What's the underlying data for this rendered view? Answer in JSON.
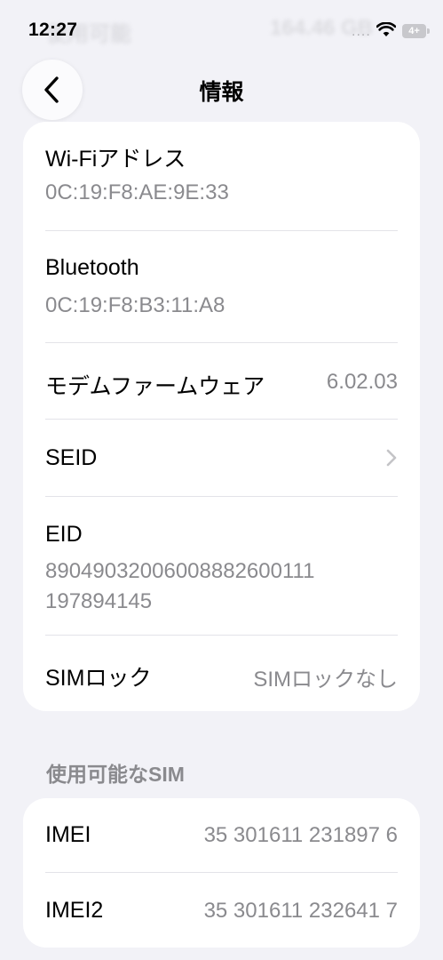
{
  "status_bar": {
    "time": "12:27",
    "ghost_left": "使用可能",
    "ghost_right": "164.46 GB",
    "signal": "....",
    "battery": "4+"
  },
  "nav": {
    "title": "情報",
    "back_icon": "chevron-left-icon"
  },
  "rows": {
    "wifi": {
      "label": "Wi-Fiアドレス",
      "value": "0C:19:F8:AE:9E:33"
    },
    "bluetooth": {
      "label": "Bluetooth",
      "value": "0C:19:F8:B3:11:A8"
    },
    "modem": {
      "label": "モデムファームウェア",
      "value": "6.02.03"
    },
    "seid": {
      "label": "SEID",
      "icon": "chevron-right-icon"
    },
    "eid": {
      "label": "EID",
      "value_line1": "89049032006008882600111",
      "value_line2": "197894145"
    },
    "simlock": {
      "label": "SIMロック",
      "value": "SIMロックなし"
    }
  },
  "sim_section": {
    "header": "使用可能なSIM",
    "imei": {
      "label": "IMEI",
      "value": "35 301611 231897 6"
    },
    "imei2": {
      "label": "IMEI2",
      "value": "35 301611 232641 7"
    }
  },
  "colors": {
    "background": "#f2f2f7",
    "card": "#ffffff",
    "secondary_text": "#8a8a8e",
    "separator": "#e3e3e8"
  }
}
